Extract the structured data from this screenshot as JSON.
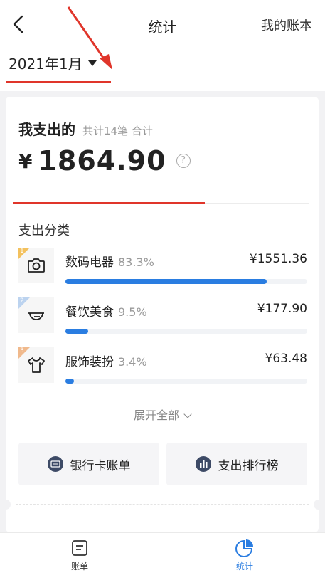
{
  "header": {
    "title": "统计",
    "right_link": "我的账本"
  },
  "month_picker": {
    "label": "2021年1月"
  },
  "summary": {
    "title": "我支出的",
    "count_text": "共计14笔 合计",
    "currency": "¥",
    "amount": "1864.90",
    "help": "?"
  },
  "categories": {
    "title": "支出分类",
    "items": [
      {
        "rank": "1",
        "name": "数码电器",
        "percent": "83.3%",
        "amount": "¥1551.36",
        "fraction": 0.833
      },
      {
        "rank": "2",
        "name": "餐饮美食",
        "percent": "9.5%",
        "amount": "¥177.90",
        "fraction": 0.095
      },
      {
        "rank": "3",
        "name": "服饰装扮",
        "percent": "3.4%",
        "amount": "¥63.48",
        "fraction": 0.034
      }
    ]
  },
  "expand_label": "展开全部",
  "buttons": {
    "bank_bill": "银行卡账单",
    "ranking": "支出排行榜"
  },
  "tabbar": {
    "ledger": "账单",
    "stats": "统计"
  },
  "colors": {
    "accent": "#2a7de1",
    "annotation_red": "#e0352a"
  }
}
